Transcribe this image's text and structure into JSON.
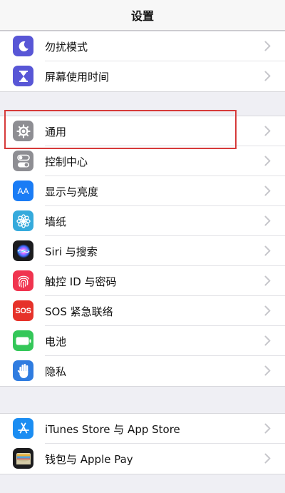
{
  "navbar": {
    "title": "设置"
  },
  "colors": {
    "highlight": "#d63a3a",
    "chevron": "#c7c7cc"
  },
  "groups": [
    {
      "items": [
        {
          "label": "勿扰模式",
          "icon": "moon-icon",
          "icon_color": "#5856d6"
        },
        {
          "label": "屏幕使用时间",
          "icon": "hourglass-icon",
          "icon_color": "#5856d6"
        }
      ]
    },
    {
      "items": [
        {
          "label": "通用",
          "icon": "gear-icon",
          "icon_color": "#8e8e93",
          "highlighted": true
        },
        {
          "label": "控制中心",
          "icon": "toggles-icon",
          "icon_color": "#8e8e93"
        },
        {
          "label": "显示与亮度",
          "icon": "display-aa-icon",
          "icon_color": "#1a7cf5",
          "icon_text": "AA"
        },
        {
          "label": "墙纸",
          "icon": "flower-icon",
          "icon_color": "#35aadc"
        },
        {
          "label": "Siri 与搜索",
          "icon": "siri-icon",
          "icon_color": "#1c1c1e"
        },
        {
          "label": "触控 ID 与密码",
          "icon": "fingerprint-icon",
          "icon_color": "#f0344f"
        },
        {
          "label": "SOS 紧急联络",
          "icon": "sos-icon",
          "icon_color": "#e6322a",
          "icon_text": "SOS"
        },
        {
          "label": "电池",
          "icon": "battery-icon",
          "icon_color": "#34c759"
        },
        {
          "label": "隐私",
          "icon": "hand-icon",
          "icon_color": "#2f7ce0"
        }
      ]
    },
    {
      "items": [
        {
          "label": "iTunes Store 与 App Store",
          "icon": "app-store-icon",
          "icon_color": "#1b8df2"
        },
        {
          "label": "钱包与 Apple Pay",
          "icon": "wallet-icon",
          "icon_color": "#1c1c1e"
        }
      ]
    }
  ]
}
